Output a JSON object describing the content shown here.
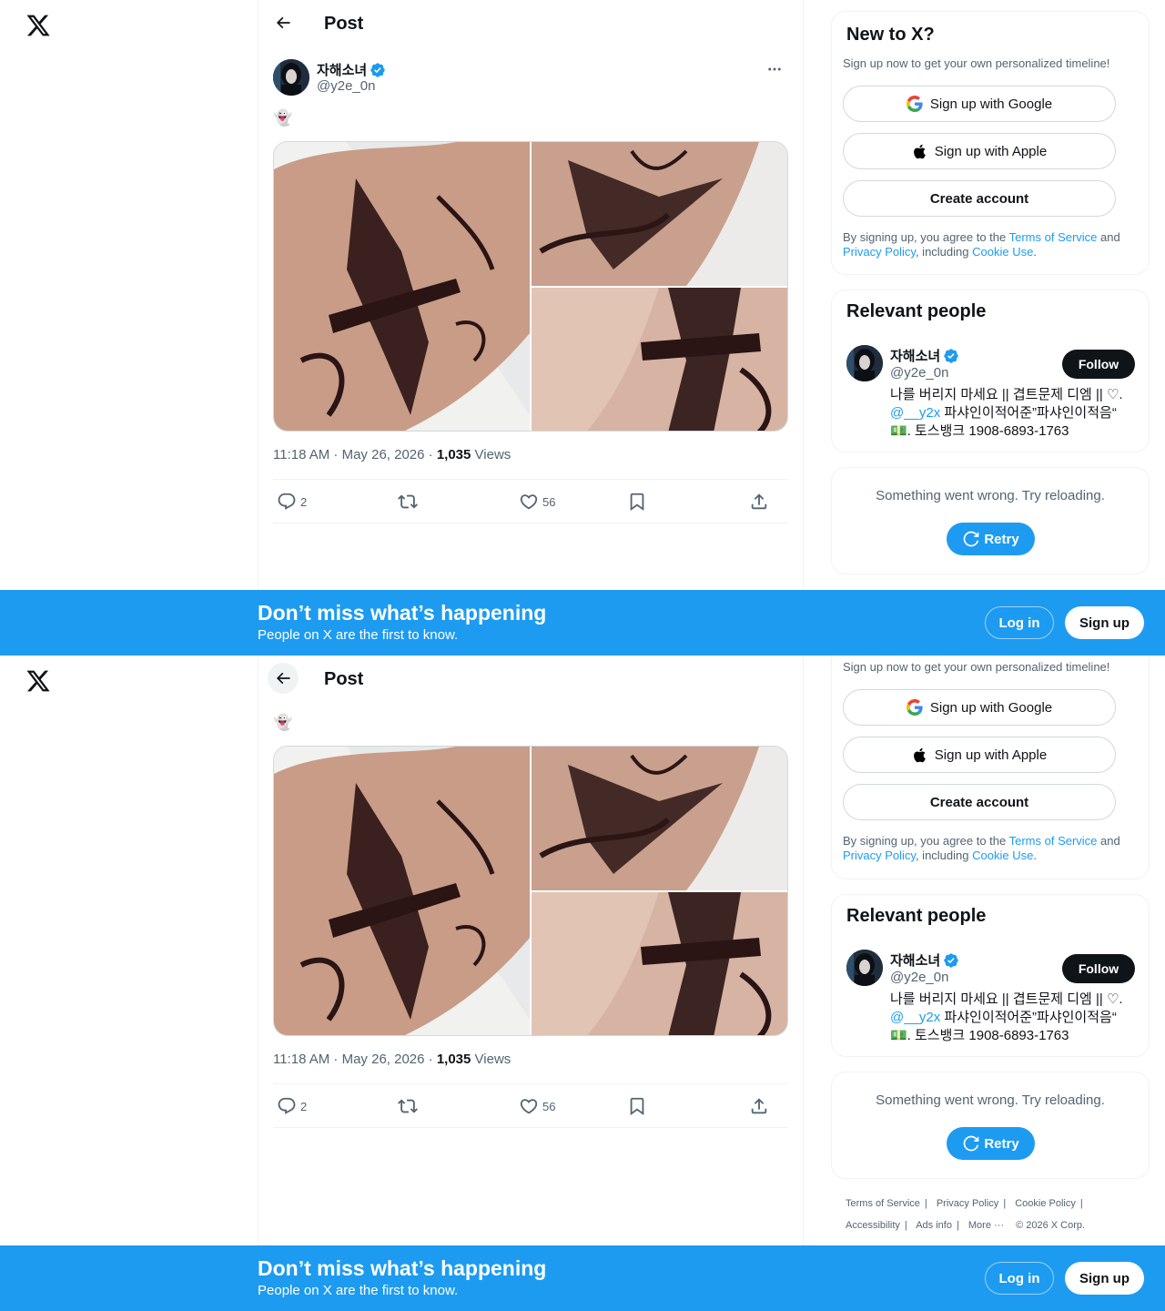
{
  "app": {
    "logo": "x-logo"
  },
  "header": {
    "title": "Post",
    "back_icon": "arrow-left-icon"
  },
  "post": {
    "author_name": "자해소녀",
    "author_handle": "@y2e_0n",
    "verified": true,
    "text": "👻",
    "timestamp": "11:18 AM · May 26, 2026 · ",
    "views_count": "1,035",
    "views_label": " Views",
    "images": [
      "tattoo-thigh-photo",
      "tattoo-leg-photo-1",
      "tattoo-leg-photo-2"
    ],
    "actions": {
      "reply_count": "2",
      "repost_count": "",
      "like_count": "56"
    }
  },
  "signup_card": {
    "title": "New to X?",
    "subtitle": "Sign up now to get your own personalized timeline!",
    "google_label": "Sign up with Google",
    "apple_label": "Sign up with Apple",
    "create_label": "Create account",
    "legal_prefix": "By signing up, you agree to the ",
    "terms_link": "Terms of Service",
    "and_text": " and ",
    "privacy_link": "Privacy Policy",
    "including_text": ", including ",
    "cookie_link": "Cookie Use",
    "period": "."
  },
  "relevant_people": {
    "title": "Relevant people",
    "name": "자해소녀",
    "handle": "@y2e_0n",
    "follow_label": "Follow",
    "bio_line1": "나를 버리지 마세요 || 겹트문제 디엠 || ♡.",
    "bio_mention": "@__y2x",
    "bio_line2_rest": " 파샤인이적어준”파샤인이적음“",
    "bio_line3": "💵. 토스뱅크 1908-6893-1763"
  },
  "trends_error": {
    "message": "Something went wrong. Try reloading.",
    "retry_label": "Retry"
  },
  "footer": {
    "links": [
      "Terms of Service",
      "Privacy Policy",
      "Cookie Policy",
      "Accessibility",
      "Ads info",
      "More ···"
    ],
    "copyright": "© 2026 X Corp."
  },
  "banner": {
    "title": "Don’t miss what’s happening",
    "subtitle": "People on X are the first to know.",
    "login_label": "Log in",
    "signup_label": "Sign up"
  },
  "colors": {
    "accent": "#1d9bf0",
    "text": "#0f1419",
    "secondary_text": "#536471",
    "border": "#eff3f4"
  }
}
